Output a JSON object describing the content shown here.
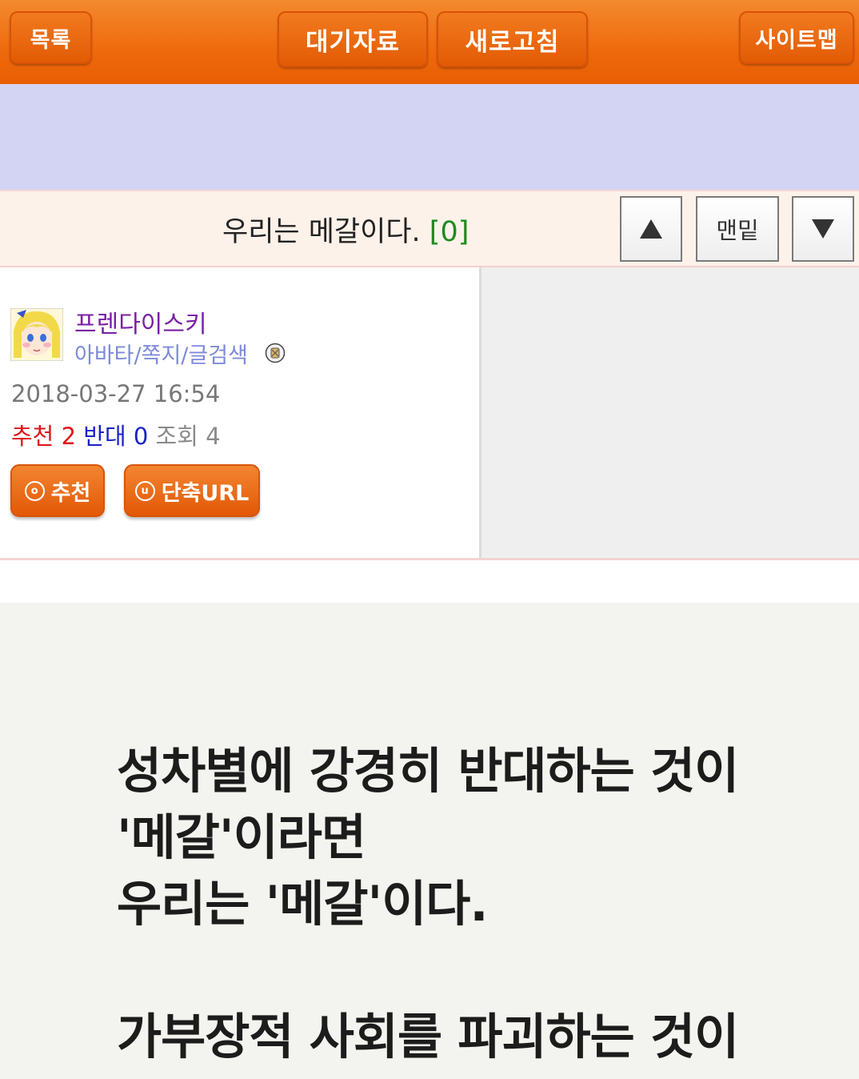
{
  "topbar": {
    "list_label": "목록",
    "wait_label": "대기자료",
    "refresh_label": "새로고침",
    "sitemap_label": "사이트맵"
  },
  "post": {
    "title": "우리는 메갈이다.",
    "comment_count": "[0]",
    "nav_up": "▲",
    "nav_bottom": "맨밑",
    "nav_down": "▼"
  },
  "author": {
    "nickname": "프렌다이스키",
    "links": "아바타/쪽지/글검색",
    "date": "2018-03-27 16:54"
  },
  "stats": {
    "recommend_label": "추천",
    "recommend_value": "2",
    "oppose_label": "반대",
    "oppose_value": "0",
    "view_label": "조회",
    "view_value": "4"
  },
  "actions": {
    "recommend_icon": "o",
    "recommend_label": "추천",
    "shorturl_icon": "u",
    "shorturl_label": "단축URL"
  },
  "content": {
    "lines": [
      "성차별에 강경히 반대하는 것이",
      "'메갈'이라면",
      "우리는 '메갈'이다.",
      "",
      "가부장적 사회를 파괴하는 것이"
    ]
  },
  "colors": {
    "topbar": "#ef6a0c",
    "banner": "#d3d3f3",
    "title_bg": "#fdf2ea",
    "nickname": "#7a1fa5",
    "recommend": "#e0141a",
    "oppose": "#1a22c9"
  }
}
